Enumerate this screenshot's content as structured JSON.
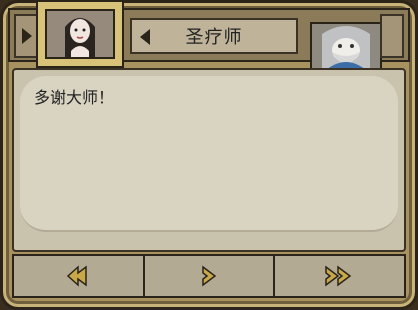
{
  "header": {
    "speaker_name": "圣疗师"
  },
  "dialog": {
    "text": "多谢大师！"
  },
  "controls": {
    "rewind_icon": "double-left-arrow-icon",
    "next_icon": "right-arrow-icon",
    "fast_forward_icon": "double-right-arrow-icon"
  },
  "colors": {
    "frame": "#a8925f",
    "panel": "#c9c2ad",
    "button_arrow": "#c9a84a"
  }
}
